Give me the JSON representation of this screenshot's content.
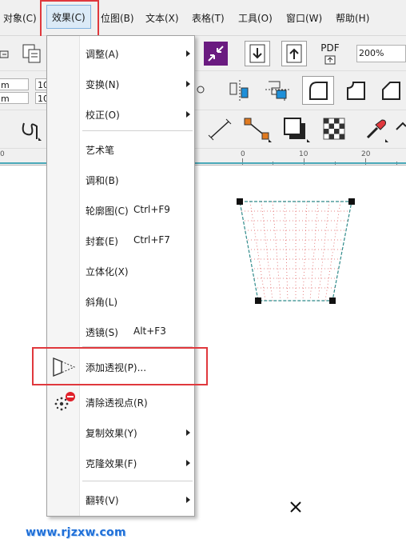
{
  "menubar": {
    "items": [
      {
        "label": "对象(C)"
      },
      {
        "label": "效果(C)",
        "active": true
      },
      {
        "label": "位图(B)"
      },
      {
        "label": "文本(X)"
      },
      {
        "label": "表格(T)"
      },
      {
        "label": "工具(O)"
      },
      {
        "label": "窗口(W)"
      },
      {
        "label": "帮助(H)"
      }
    ]
  },
  "toolbar": {
    "pdf_label": "PDF",
    "zoom_value": "200%",
    "fields": [
      "m",
      "m",
      "10",
      "10"
    ],
    "icons": [
      "arrange-icon",
      "copy-properties-icon",
      "collapse-arrows-icon",
      "import-icon",
      "export-icon",
      "publish-pdf-icon"
    ]
  },
  "property_bar": {
    "icons": [
      "node-icon",
      "align-icon",
      "path-node-icon",
      "corner-round-icon",
      "corner-scallop-icon",
      "corner-chamfer-icon"
    ]
  },
  "toolbox_row": {
    "icons": [
      "freehand-curve-icon",
      "dimension-icon",
      "connector-icon",
      "drop-shadow-icon",
      "transparency-icon",
      "eyedropper-icon",
      "fill-icon"
    ]
  },
  "ruler": {
    "labels": [
      "0",
      "0",
      "10",
      "20"
    ]
  },
  "effects_menu": {
    "items": [
      {
        "label": "调整(A)",
        "submenu": true
      },
      {
        "label": "变换(N)",
        "submenu": true
      },
      {
        "label": "校正(O)",
        "submenu": true
      },
      {
        "label": "艺术笔"
      },
      {
        "label": "调和(B)"
      },
      {
        "label": "轮廓图(C)",
        "shortcut": "Ctrl+F9"
      },
      {
        "label": "封套(E)",
        "shortcut": "Ctrl+F7"
      },
      {
        "label": "立体化(X)"
      },
      {
        "label": "斜角(L)"
      },
      {
        "label": "透镜(S)",
        "shortcut": "Alt+F3"
      },
      {
        "label": "添加透视(P)...",
        "icon": "add-perspective-icon",
        "highlighted": true
      },
      {
        "label": "清除透视点(R)",
        "icon": "clear-perspective-icon"
      },
      {
        "label": "复制效果(Y)",
        "submenu": true
      },
      {
        "label": "克隆效果(F)",
        "submenu": true
      },
      {
        "label": "翻转(V)",
        "submenu": true
      }
    ]
  },
  "canvas": {
    "shape": "perspective-trapezoid",
    "grid_color": "#e06060",
    "outline_color": "#2f8a8a"
  },
  "watermark": "www.rjzxw.com",
  "colors": {
    "highlight": "#e0383d",
    "menu_active_bg": "#dbeaf7",
    "toolbar_bg": "#f0f0f0",
    "accent_magenta": "#7a1a8a",
    "accent_blue": "#1e8fd8"
  }
}
